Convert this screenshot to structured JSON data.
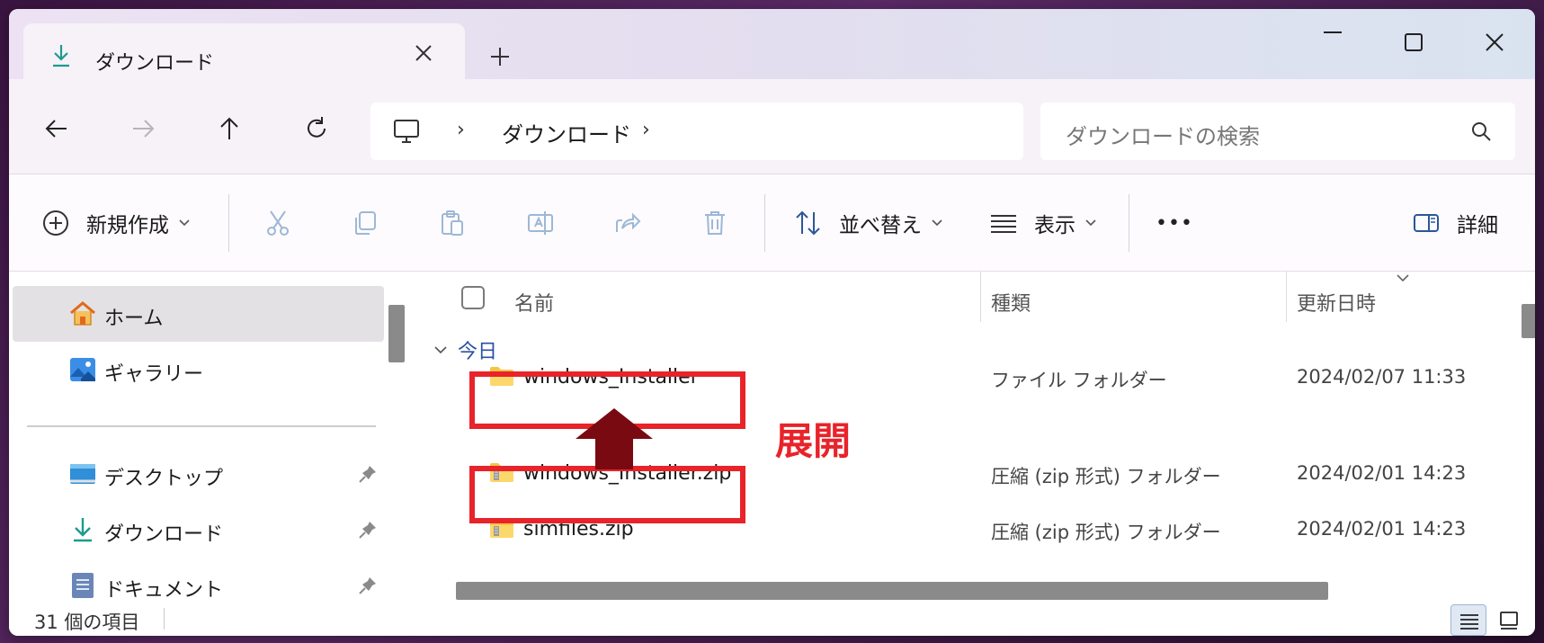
{
  "tab": {
    "title": "ダウンロード"
  },
  "address": {
    "crumb": "ダウンロード",
    "separator": "›"
  },
  "search": {
    "placeholder": "ダウンロードの検索"
  },
  "toolbar": {
    "new_label": "新規作成",
    "sort_label": "並べ替え",
    "view_label": "表示",
    "more_label": "•••",
    "details_label": "詳細"
  },
  "nav": {
    "items": [
      {
        "label": "ホーム",
        "icon": "home-icon",
        "selected": true
      },
      {
        "label": "ギャラリー",
        "icon": "gallery-icon"
      },
      {
        "label": "デスクトップ",
        "icon": "desktop-icon",
        "pinned": true
      },
      {
        "label": "ダウンロード",
        "icon": "download-icon",
        "pinned": true
      },
      {
        "label": "ドキュメント",
        "icon": "documents-icon",
        "pinned": true
      }
    ]
  },
  "columns": {
    "name": "名前",
    "type": "種類",
    "modified": "更新日時"
  },
  "group": {
    "label": "今日"
  },
  "files": [
    {
      "name": "windows_Installer",
      "type": "ファイル フォルダー",
      "date": "2024/02/07 11:33",
      "icon": "folder-icon"
    },
    {
      "name": "windows_Installer.zip",
      "type": "圧縮 (zip 形式) フォルダー",
      "date": "2024/02/01 14:23",
      "icon": "zip-folder-icon"
    },
    {
      "name": "simfiles.zip",
      "type": "圧縮 (zip 形式) フォルダー",
      "date": "2024/02/01 14:23",
      "icon": "zip-folder-icon"
    }
  ],
  "annotation": {
    "text": "展開",
    "color": "#e8232a"
  },
  "status": {
    "count": "31 個の項目"
  },
  "colors": {
    "accent": "#2b4fa3",
    "highlight": "#e8232a",
    "arrow": "#7a0a12"
  }
}
